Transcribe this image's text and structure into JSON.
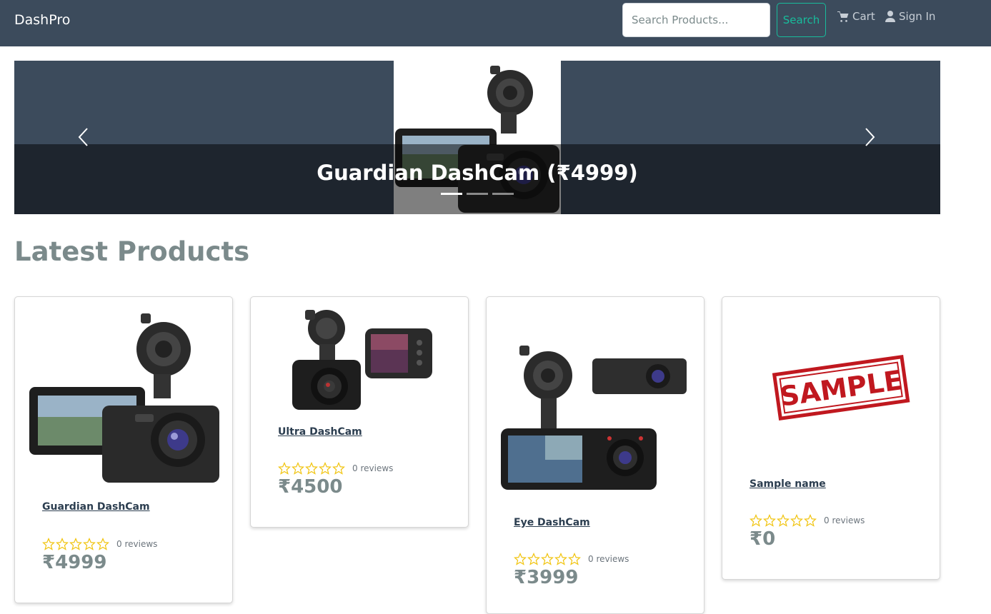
{
  "navbar": {
    "brand": "DashPro",
    "search_placeholder": "Search Products...",
    "search_button": "Search",
    "cart": "Cart",
    "sign_in": "Sign In"
  },
  "carousel": {
    "caption": "Guardian DashCam (₹4999)",
    "active_index": 0,
    "slide_count": 3
  },
  "section": {
    "title": "Latest Products"
  },
  "products": [
    {
      "name": "Guardian DashCam",
      "reviews": "0 reviews",
      "price": "₹4999",
      "rating": 0,
      "image": "dashcam-photo"
    },
    {
      "name": "Ultra DashCam",
      "reviews": "0 reviews",
      "price": "₹4500",
      "rating": 0,
      "image": "dashcam-photo"
    },
    {
      "name": "Eye DashCam",
      "reviews": "0 reviews",
      "price": "₹3999",
      "rating": 0,
      "image": "dashcam-photo"
    },
    {
      "name": "Sample name",
      "reviews": "0 reviews",
      "price": "₹0",
      "rating": 0,
      "image": "sample-stamp",
      "stamp_text": "SAMPLE"
    }
  ],
  "colors": {
    "navbar": "#3c4b5c",
    "accent": "#18bc9c",
    "star": "#f1c40f",
    "price": "#7b8a8b",
    "stamp": "#c0181f"
  },
  "icons": [
    "cart-icon",
    "user-icon",
    "chevron-left-icon",
    "chevron-right-icon",
    "star-icon"
  ]
}
